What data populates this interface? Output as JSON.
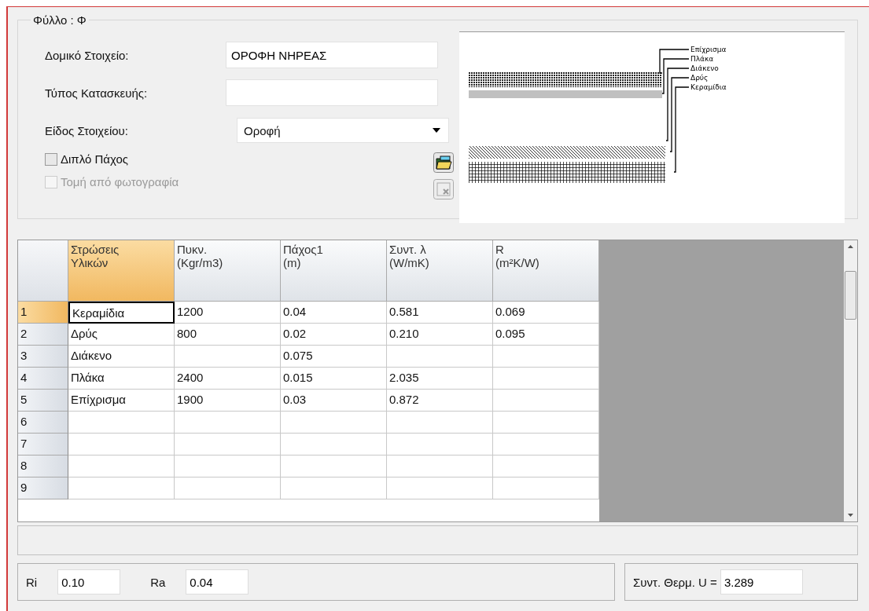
{
  "group_title": "Φύλλο : Φ",
  "fields": [
    {
      "label": "Δομικό Στοιχείο:",
      "value": "ΟΡΟΦΗ ΝΗΡΕΑΣ"
    },
    {
      "label": "Τύπος Κατασκευής:"
    }
  ],
  "element_type": {
    "label": "Είδος Στοιχείου:",
    "value": "Οροφή"
  },
  "checkboxes": [
    {
      "label": "Διπλό Πάχος",
      "checked": false,
      "disabled": false
    },
    {
      "label": "Τομή από φωτογραφία",
      "checked": false,
      "disabled": true
    }
  ],
  "preview_labels": [
    "Επίχρισμα",
    "Πλάκα",
    "Διάκενο",
    "Δρύς",
    "Κεραμίδια"
  ],
  "table": {
    "columns": [
      {
        "label": "Στρώσεις\nΥλικών",
        "selected": true
      },
      {
        "label": "Πυκν.\n(Kgr/m3)",
        "selected": false
      },
      {
        "label": "Πάχος1\n(m)",
        "selected": false
      },
      {
        "label": "Συντ. λ\n(W/mK)",
        "selected": false
      },
      {
        "label": "R\n(m²K/W)",
        "selected": false
      }
    ],
    "rows": [
      {
        "number": "1",
        "selected": true,
        "cells": [
          "Κεραμίδια",
          "1200",
          "0.04",
          "0.581",
          "0.069"
        ]
      },
      {
        "number": "2",
        "selected": false,
        "cells": [
          "Δρύς",
          "800",
          "0.02",
          "0.210",
          "0.095"
        ]
      },
      {
        "number": "3",
        "selected": false,
        "cells": [
          "Διάκενο",
          null,
          "0.075",
          null,
          null
        ]
      },
      {
        "number": "4",
        "selected": false,
        "cells": [
          "Πλάκα",
          "2400",
          "0.015",
          "2.035",
          null
        ]
      },
      {
        "number": "5",
        "selected": false,
        "cells": [
          "Επίχρισμα",
          "1900",
          "0.03",
          "0.872",
          null
        ]
      },
      {
        "number": "6",
        "selected": false
      },
      {
        "number": "7",
        "selected": false
      },
      {
        "number": "8",
        "selected": false
      },
      {
        "number": "9",
        "selected": false
      }
    ]
  },
  "bottom": {
    "ri_label": "Ri",
    "ri": "0.10",
    "ra_label": "Ra",
    "ra": "0.04",
    "u_label": "Συντ. Θερμ. U =",
    "u": "3.289"
  }
}
